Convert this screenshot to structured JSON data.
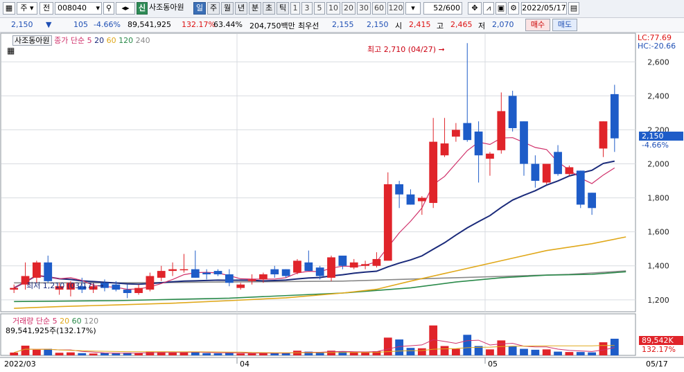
{
  "toolbar": {
    "market": "주",
    "type": "전",
    "code": "008040",
    "new_label": "신",
    "stock_name": "사조동아원",
    "periods": [
      "일",
      "주",
      "월",
      "년",
      "분",
      "초",
      "틱"
    ],
    "intervals": [
      "1",
      "3",
      "5",
      "10",
      "20",
      "30",
      "60",
      "120"
    ],
    "count": "52",
    "count_max": "/600",
    "date": "2022/05/17"
  },
  "info": {
    "price": "2,150",
    "change": "105",
    "change_pct": "-4.66%",
    "volume": "89,541,925",
    "vol_ratio": "132.17%",
    "turnover": "63.44%",
    "amount": "204,750백만",
    "best_label": "최우선",
    "ask": "2,155",
    "bid": "2,150",
    "open_label": "시",
    "open": "2,415",
    "high_label": "고",
    "high": "2,465",
    "low_label": "저",
    "low": "2,070",
    "buy": "매수",
    "sell": "매도"
  },
  "colors": {
    "up": "#e0242a",
    "down": "#1e5cc8",
    "ma5": "#d0306a",
    "ma20": "#1a2a7a",
    "ma60": "#e0a81a",
    "ma120": "#2a8a4a",
    "ma240": "#888888"
  },
  "legend": {
    "name": "사조동아원",
    "price_label": "종가 단순",
    "p": [
      "5",
      "20",
      "60",
      "120",
      "240"
    ]
  },
  "vol_legend": {
    "label": "거래량 단순",
    "p": [
      "5",
      "20",
      "60",
      "120"
    ],
    "value": "89,541,925주(132.17%)"
  },
  "annotations": {
    "high_text": "최고 2,710 (04/27)",
    "low_text": "최저 1,210 (03/17)",
    "lc": "LC:77.69",
    "hc": "HC:-20.66",
    "last_price": "2,150",
    "last_pct": "-4.66%",
    "vol_last": "89,542K",
    "vol_pct": "132.17%"
  },
  "x_labels": [
    "2022/03",
    "04",
    "05",
    "05/17"
  ],
  "chart_data": {
    "type": "candlestick",
    "y_ticks": [
      1200,
      1400,
      1600,
      1800,
      2000,
      2200,
      2400,
      2600
    ],
    "ylim": [
      1130,
      2760
    ],
    "candles": [
      {
        "o": 1260,
        "h": 1290,
        "l": 1240,
        "c": 1270,
        "v": 1.5
      },
      {
        "o": 1290,
        "h": 1420,
        "l": 1260,
        "c": 1340,
        "v": 5.2
      },
      {
        "o": 1330,
        "h": 1430,
        "l": 1300,
        "c": 1420,
        "v": 3.0
      },
      {
        "o": 1420,
        "h": 1460,
        "l": 1300,
        "c": 1310,
        "v": 3.5
      },
      {
        "o": 1260,
        "h": 1300,
        "l": 1230,
        "c": 1280,
        "v": 1.4
      },
      {
        "o": 1260,
        "h": 1310,
        "l": 1220,
        "c": 1300,
        "v": 1.6
      },
      {
        "o": 1280,
        "h": 1330,
        "l": 1240,
        "c": 1260,
        "v": 1.2
      },
      {
        "o": 1260,
        "h": 1300,
        "l": 1240,
        "c": 1280,
        "v": 1.0
      },
      {
        "o": 1300,
        "h": 1320,
        "l": 1250,
        "c": 1270,
        "v": 1.3
      },
      {
        "o": 1290,
        "h": 1310,
        "l": 1250,
        "c": 1260,
        "v": 1.1
      },
      {
        "o": 1260,
        "h": 1290,
        "l": 1210,
        "c": 1240,
        "v": 1.4
      },
      {
        "o": 1240,
        "h": 1290,
        "l": 1230,
        "c": 1270,
        "v": 1.2
      },
      {
        "o": 1260,
        "h": 1360,
        "l": 1250,
        "c": 1340,
        "v": 2.0
      },
      {
        "o": 1330,
        "h": 1400,
        "l": 1310,
        "c": 1370,
        "v": 1.8
      },
      {
        "o": 1370,
        "h": 1420,
        "l": 1340,
        "c": 1380,
        "v": 1.5
      },
      {
        "o": 1380,
        "h": 1470,
        "l": 1360,
        "c": 1380,
        "v": 1.5
      },
      {
        "o": 1380,
        "h": 1490,
        "l": 1330,
        "c": 1330,
        "v": 2.0
      },
      {
        "o": 1360,
        "h": 1380,
        "l": 1320,
        "c": 1350,
        "v": 1.2
      },
      {
        "o": 1370,
        "h": 1380,
        "l": 1340,
        "c": 1350,
        "v": 1.1
      },
      {
        "o": 1350,
        "h": 1380,
        "l": 1280,
        "c": 1300,
        "v": 1.3
      },
      {
        "o": 1270,
        "h": 1300,
        "l": 1260,
        "c": 1290,
        "v": 1.0
      },
      {
        "o": 1310,
        "h": 1350,
        "l": 1290,
        "c": 1320,
        "v": 1.1
      },
      {
        "o": 1320,
        "h": 1360,
        "l": 1300,
        "c": 1350,
        "v": 1.4
      },
      {
        "o": 1380,
        "h": 1400,
        "l": 1330,
        "c": 1350,
        "v": 1.2
      },
      {
        "o": 1380,
        "h": 1380,
        "l": 1330,
        "c": 1340,
        "v": 1.2
      },
      {
        "o": 1360,
        "h": 1440,
        "l": 1350,
        "c": 1430,
        "v": 2.5
      },
      {
        "o": 1420,
        "h": 1490,
        "l": 1370,
        "c": 1370,
        "v": 2.0
      },
      {
        "o": 1390,
        "h": 1400,
        "l": 1320,
        "c": 1340,
        "v": 1.5
      },
      {
        "o": 1330,
        "h": 1460,
        "l": 1310,
        "c": 1450,
        "v": 2.5
      },
      {
        "o": 1460,
        "h": 1460,
        "l": 1380,
        "c": 1400,
        "v": 2.0
      },
      {
        "o": 1390,
        "h": 1440,
        "l": 1380,
        "c": 1420,
        "v": 1.8
      },
      {
        "o": 1400,
        "h": 1430,
        "l": 1380,
        "c": 1410,
        "v": 1.5
      },
      {
        "o": 1400,
        "h": 1480,
        "l": 1390,
        "c": 1440,
        "v": 2.2
      },
      {
        "o": 1430,
        "h": 1950,
        "l": 1440,
        "c": 1880,
        "v": 9.5
      },
      {
        "o": 1880,
        "h": 1900,
        "l": 1740,
        "c": 1820,
        "v": 8.5
      },
      {
        "o": 1820,
        "h": 1850,
        "l": 1760,
        "c": 1760,
        "v": 4.0
      },
      {
        "o": 1780,
        "h": 1810,
        "l": 1700,
        "c": 1800,
        "v": 3.8
      },
      {
        "o": 1770,
        "h": 2270,
        "l": 1740,
        "c": 2130,
        "v": 16.0
      },
      {
        "o": 2050,
        "h": 2270,
        "l": 2040,
        "c": 2120,
        "v": 5.0
      },
      {
        "o": 2160,
        "h": 2240,
        "l": 2130,
        "c": 2200,
        "v": 3.5
      },
      {
        "o": 2240,
        "h": 2710,
        "l": 2130,
        "c": 2140,
        "v": 11.0
      },
      {
        "o": 2190,
        "h": 2250,
        "l": 1890,
        "c": 2050,
        "v": 5.0
      },
      {
        "o": 2030,
        "h": 2070,
        "l": 1930,
        "c": 2060,
        "v": 3.2
      },
      {
        "o": 2080,
        "h": 2420,
        "l": 2060,
        "c": 2310,
        "v": 8.0
      },
      {
        "o": 2400,
        "h": 2430,
        "l": 2190,
        "c": 2210,
        "v": 5.0
      },
      {
        "o": 2250,
        "h": 2250,
        "l": 1930,
        "c": 2000,
        "v": 3.5
      },
      {
        "o": 2000,
        "h": 2050,
        "l": 1860,
        "c": 1900,
        "v": 3.0
      },
      {
        "o": 1890,
        "h": 2000,
        "l": 1880,
        "c": 2000,
        "v": 3.2
      },
      {
        "o": 2070,
        "h": 2110,
        "l": 1930,
        "c": 1940,
        "v": 2.0
      },
      {
        "o": 1940,
        "h": 1990,
        "l": 1930,
        "c": 1980,
        "v": 1.8
      },
      {
        "o": 1960,
        "h": 1960,
        "l": 1740,
        "c": 1760,
        "v": 1.8
      },
      {
        "o": 1830,
        "h": 1830,
        "l": 1700,
        "c": 1740,
        "v": 1.6
      },
      {
        "o": 2090,
        "h": 2250,
        "l": 2040,
        "c": 2250,
        "v": 7.0
      },
      {
        "o": 2410,
        "h": 2465,
        "l": 2070,
        "c": 2150,
        "v": 8.9
      }
    ],
    "ma60": [
      [
        1,
        1150
      ],
      [
        5,
        1160
      ],
      [
        10,
        1170
      ],
      [
        15,
        1180
      ],
      [
        20,
        1195
      ],
      [
        25,
        1212
      ],
      [
        30,
        1240
      ],
      [
        33,
        1262
      ],
      [
        36,
        1310
      ],
      [
        40,
        1370
      ],
      [
        44,
        1430
      ],
      [
        48,
        1490
      ],
      [
        52,
        1530
      ],
      [
        55,
        1570
      ]
    ],
    "ma120": [
      [
        1,
        1190
      ],
      [
        10,
        1195
      ],
      [
        20,
        1210
      ],
      [
        30,
        1240
      ],
      [
        36,
        1270
      ],
      [
        40,
        1305
      ],
      [
        44,
        1330
      ],
      [
        48,
        1345
      ],
      [
        52,
        1350
      ],
      [
        55,
        1365
      ]
    ],
    "ma240": [
      [
        1,
        1300
      ],
      [
        10,
        1300
      ],
      [
        20,
        1305
      ],
      [
        30,
        1310
      ],
      [
        40,
        1330
      ],
      [
        50,
        1350
      ],
      [
        55,
        1370
      ]
    ],
    "vol_ylim": [
      0,
      20
    ]
  }
}
